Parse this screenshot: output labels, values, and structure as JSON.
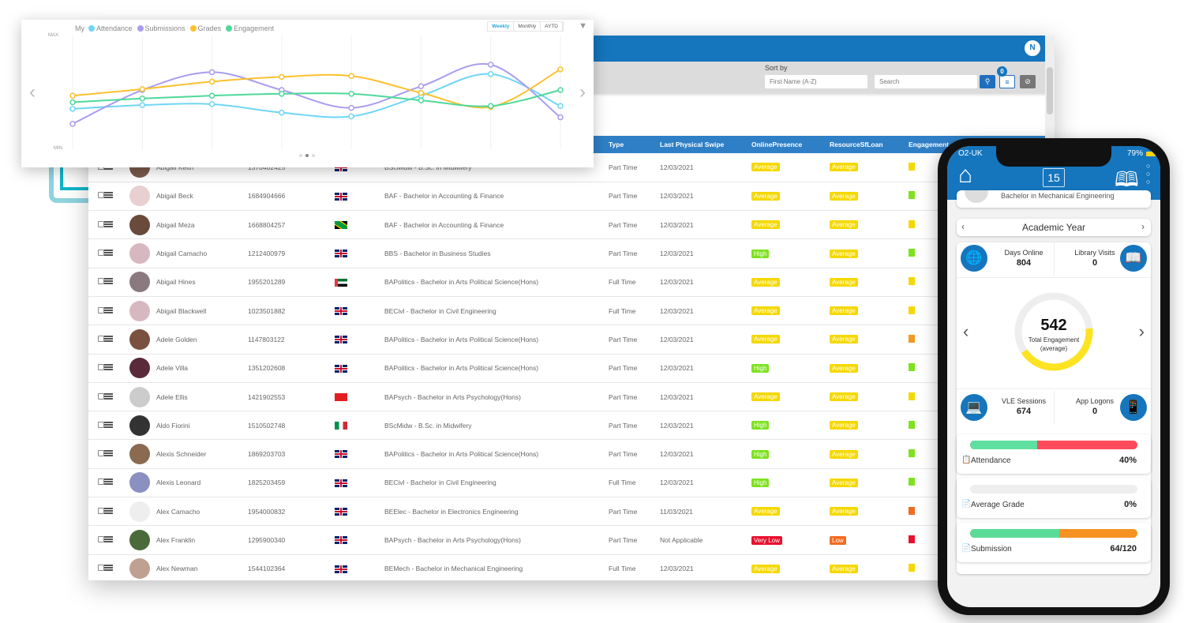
{
  "app": {
    "avatar_initial": "N",
    "sort_label": "Sort by",
    "sort_value": "First Name (A-Z)",
    "search_placeholder": "Search",
    "filter_count": "0"
  },
  "table": {
    "headers": [
      "Type",
      "Last Physical Swipe",
      "OnlinePresence",
      "ResourceSfLoan",
      "Engagement"
    ],
    "rows": [
      {
        "name": "Abigail Keith",
        "id": "1370402425",
        "flag": "uk",
        "course": "BScMidw - B.Sc. in Midwifery",
        "type": "Part Time",
        "swipe": "12/03/2021",
        "online": "Average",
        "resource": "Average",
        "eng": "#f5d800",
        "avatar": "#7a5a4a"
      },
      {
        "name": "Abigail Beck",
        "id": "1684904666",
        "flag": "uk",
        "course": "BAF - Bachelor in Accounting & Finance",
        "type": "Part Time",
        "swipe": "12/03/2021",
        "online": "Average",
        "resource": "Average",
        "eng": "#7ee21e",
        "avatar": "#e8d0d0"
      },
      {
        "name": "Abigail Meza",
        "id": "1668804257",
        "flag": "jm",
        "course": "BAF - Bachelor in Accounting & Finance",
        "type": "Part Time",
        "swipe": "12/03/2021",
        "online": "Average",
        "resource": "Average",
        "eng": "#f5d800",
        "avatar": "#6a4a3a"
      },
      {
        "name": "Abigail Camacho",
        "id": "1212400979",
        "flag": "uk",
        "course": "BBS - Bachelor in Business Studies",
        "type": "Part Time",
        "swipe": "12/03/2021",
        "online": "High",
        "resource": "Average",
        "eng": "#7ee21e",
        "avatar": "#d8b8c0"
      },
      {
        "name": "Abigail Hines",
        "id": "1955201289",
        "flag": "ae",
        "course": "BAPolitics - Bachelor in Arts Political Science(Hons)",
        "type": "Full Time",
        "swipe": "12/03/2021",
        "online": "Average",
        "resource": "Average",
        "eng": "#f5d800",
        "avatar": "#8a7a80"
      },
      {
        "name": "Abigail Blackwell",
        "id": "1023501882",
        "flag": "uk",
        "course": "BECivl - Bachelor in Civil Engineering",
        "type": "Full Time",
        "swipe": "12/03/2021",
        "online": "Average",
        "resource": "Average",
        "eng": "#f5d800",
        "avatar": "#d8b8c0"
      },
      {
        "name": "Adele Golden",
        "id": "1147803122",
        "flag": "uk",
        "course": "BAPolitics - Bachelor in Arts Political Science(Hons)",
        "type": "Part Time",
        "swipe": "12/03/2021",
        "online": "Average",
        "resource": "Average",
        "eng": "#f29a1e",
        "avatar": "#7a5040"
      },
      {
        "name": "Adele Villa",
        "id": "1351202608",
        "flag": "uk",
        "course": "BAPolitics - Bachelor in Arts Political Science(Hons)",
        "type": "Part Time",
        "swipe": "12/03/2021",
        "online": "High",
        "resource": "Average",
        "eng": "#7ee21e",
        "avatar": "#5a2a3a"
      },
      {
        "name": "Adele Ellis",
        "id": "1421902553",
        "flag": "al",
        "course": "BAPsych - Bachelor in Arts Psychology(Hons)",
        "type": "Part Time",
        "swipe": "12/03/2021",
        "online": "Average",
        "resource": "Average",
        "eng": "#f5d800",
        "avatar": "#ccc"
      },
      {
        "name": "Aldo Fiorini",
        "id": "1510502748",
        "flag": "it",
        "course": "BScMidw - B.Sc. in Midwifery",
        "type": "Part Time",
        "swipe": "12/03/2021",
        "online": "High",
        "resource": "Average",
        "eng": "#7ee21e",
        "avatar": "#333"
      },
      {
        "name": "Alexis Schneider",
        "id": "1869203703",
        "flag": "uk",
        "course": "BAPolitics - Bachelor in Arts Political Science(Hons)",
        "type": "Part Time",
        "swipe": "12/03/2021",
        "online": "High",
        "resource": "Average",
        "eng": "#7ee21e",
        "avatar": "#8a6a50"
      },
      {
        "name": "Alexis Leonard",
        "id": "1825203459",
        "flag": "uk",
        "course": "BECivl - Bachelor in Civil Engineering",
        "type": "Full Time",
        "swipe": "12/03/2021",
        "online": "High",
        "resource": "Average",
        "eng": "#7ee21e",
        "avatar": "#8a90c0"
      },
      {
        "name": "Alex Camacho",
        "id": "1954000832",
        "flag": "uk",
        "course": "BEElec - Bachelor in Electronics Engineering",
        "type": "Part Time",
        "swipe": "11/03/2021",
        "online": "Average",
        "resource": "Average",
        "eng": "#f26b21",
        "avatar": "#eee"
      },
      {
        "name": "Alex Franklin",
        "id": "1295900340",
        "flag": "uk",
        "course": "BAPsych - Bachelor in Arts Psychology(Hons)",
        "type": "Part Time",
        "swipe": "Not Applicable",
        "online": "Very Low",
        "resource": "Low",
        "eng": "#e8102e",
        "avatar": "#4a6a3a"
      },
      {
        "name": "Alex Newman",
        "id": "1544102364",
        "flag": "uk",
        "course": "BEMech - Bachelor in Mechanical Engineering",
        "type": "Full Time",
        "swipe": "12/03/2021",
        "online": "Average",
        "resource": "Average",
        "eng": "#f5d800",
        "avatar": "#c0a090"
      }
    ]
  },
  "chart_data": {
    "type": "line",
    "legend_prefix": "My",
    "ylabels": [
      "MAX",
      "MIN"
    ],
    "periods": [
      "Weekly",
      "Monthly",
      "AYTD"
    ],
    "active_period": "Weekly",
    "ylim": [
      0,
      100
    ],
    "x": [
      1,
      2,
      3,
      4,
      5,
      6,
      7,
      8
    ],
    "grid": true,
    "legend": "top-left",
    "series": [
      {
        "name": "Attendance",
        "color": "#6fd6f5",
        "values": [
          43,
          47,
          48,
          39,
          35,
          57,
          80,
          46
        ]
      },
      {
        "name": "Submissions",
        "color": "#a99cf0",
        "values": [
          27,
          63,
          82,
          63,
          44,
          67,
          90,
          34
        ]
      },
      {
        "name": "Grades",
        "color": "#fbc02d",
        "values": [
          57,
          64,
          72,
          77,
          78,
          60,
          45,
          85
        ]
      },
      {
        "name": "Engagement",
        "color": "#4fd89a",
        "values": [
          50,
          54,
          57,
          59,
          59,
          52,
          46,
          63
        ]
      }
    ]
  },
  "phone": {
    "carrier": "O2-UK",
    "battery": "79%",
    "calendar_day": "15",
    "profile_course": "Bachelor in Mechanical Engineering",
    "period": "Academic Year",
    "days_online_label": "Days Online",
    "days_online": "804",
    "library_label": "Library Visits",
    "library": "0",
    "total": "542",
    "total_label": "Total Engagement",
    "total_sub": "(average)",
    "total_fraction": 0.42,
    "vle_label": "VLE Sessions",
    "vle": "674",
    "logons_label": "App Logons",
    "logons": "0",
    "attendance_label": "Attendance",
    "attendance": "40%",
    "attendance_fraction": 0.4,
    "grade_label": "Average Grade",
    "grade": "0%",
    "grade_fraction": 0,
    "submission_label": "Submission",
    "submission": "64/120",
    "submission_fraction": 0.533
  }
}
